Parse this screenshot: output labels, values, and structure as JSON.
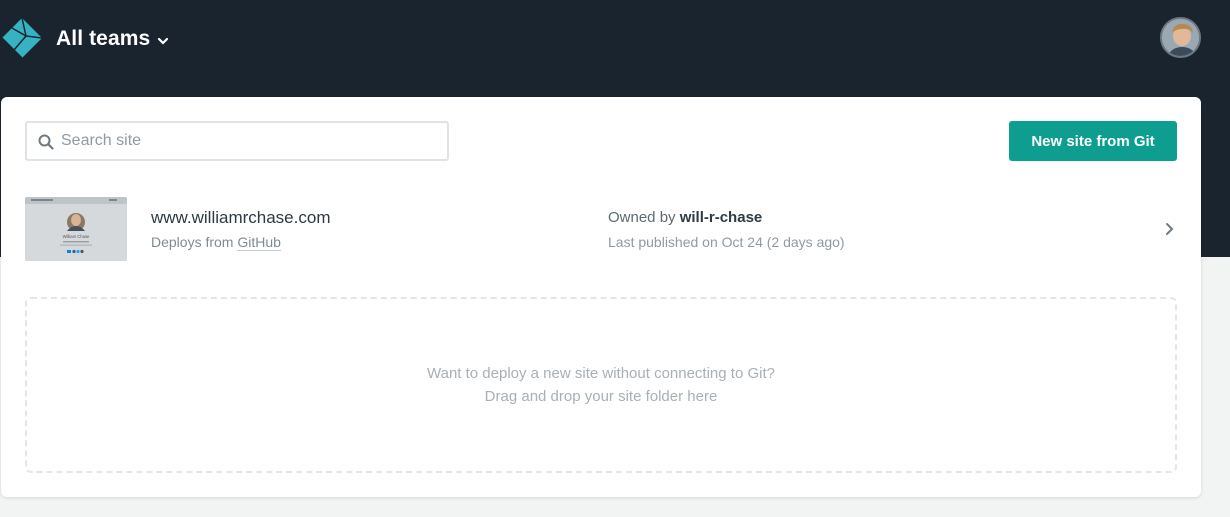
{
  "header": {
    "team_label": "All teams",
    "colors": {
      "background": "#19242e",
      "logo": "#36b3c3"
    }
  },
  "search": {
    "placeholder": "Search site",
    "value": ""
  },
  "actions": {
    "new_site_label": "New site from Git",
    "accent_color": "#0d9e8f"
  },
  "sites": [
    {
      "name": "www.williamrchase.com",
      "deploy_prefix": "Deploys from",
      "deploy_source": "GitHub",
      "owner_prefix": "Owned by",
      "owner": "will-r-chase",
      "published": "Last published on Oct 24 (2 days ago)",
      "thumbnail_name": "William Chase"
    }
  ],
  "dropzone": {
    "line1": "Want to deploy a new site without connecting to Git?",
    "line2": "Drag and drop your site folder here"
  },
  "icons": {
    "logo": "netlify-logo-icon",
    "team_chevron": "chevron-down-icon",
    "search": "search-icon",
    "row_chevron": "chevron-right-icon"
  }
}
